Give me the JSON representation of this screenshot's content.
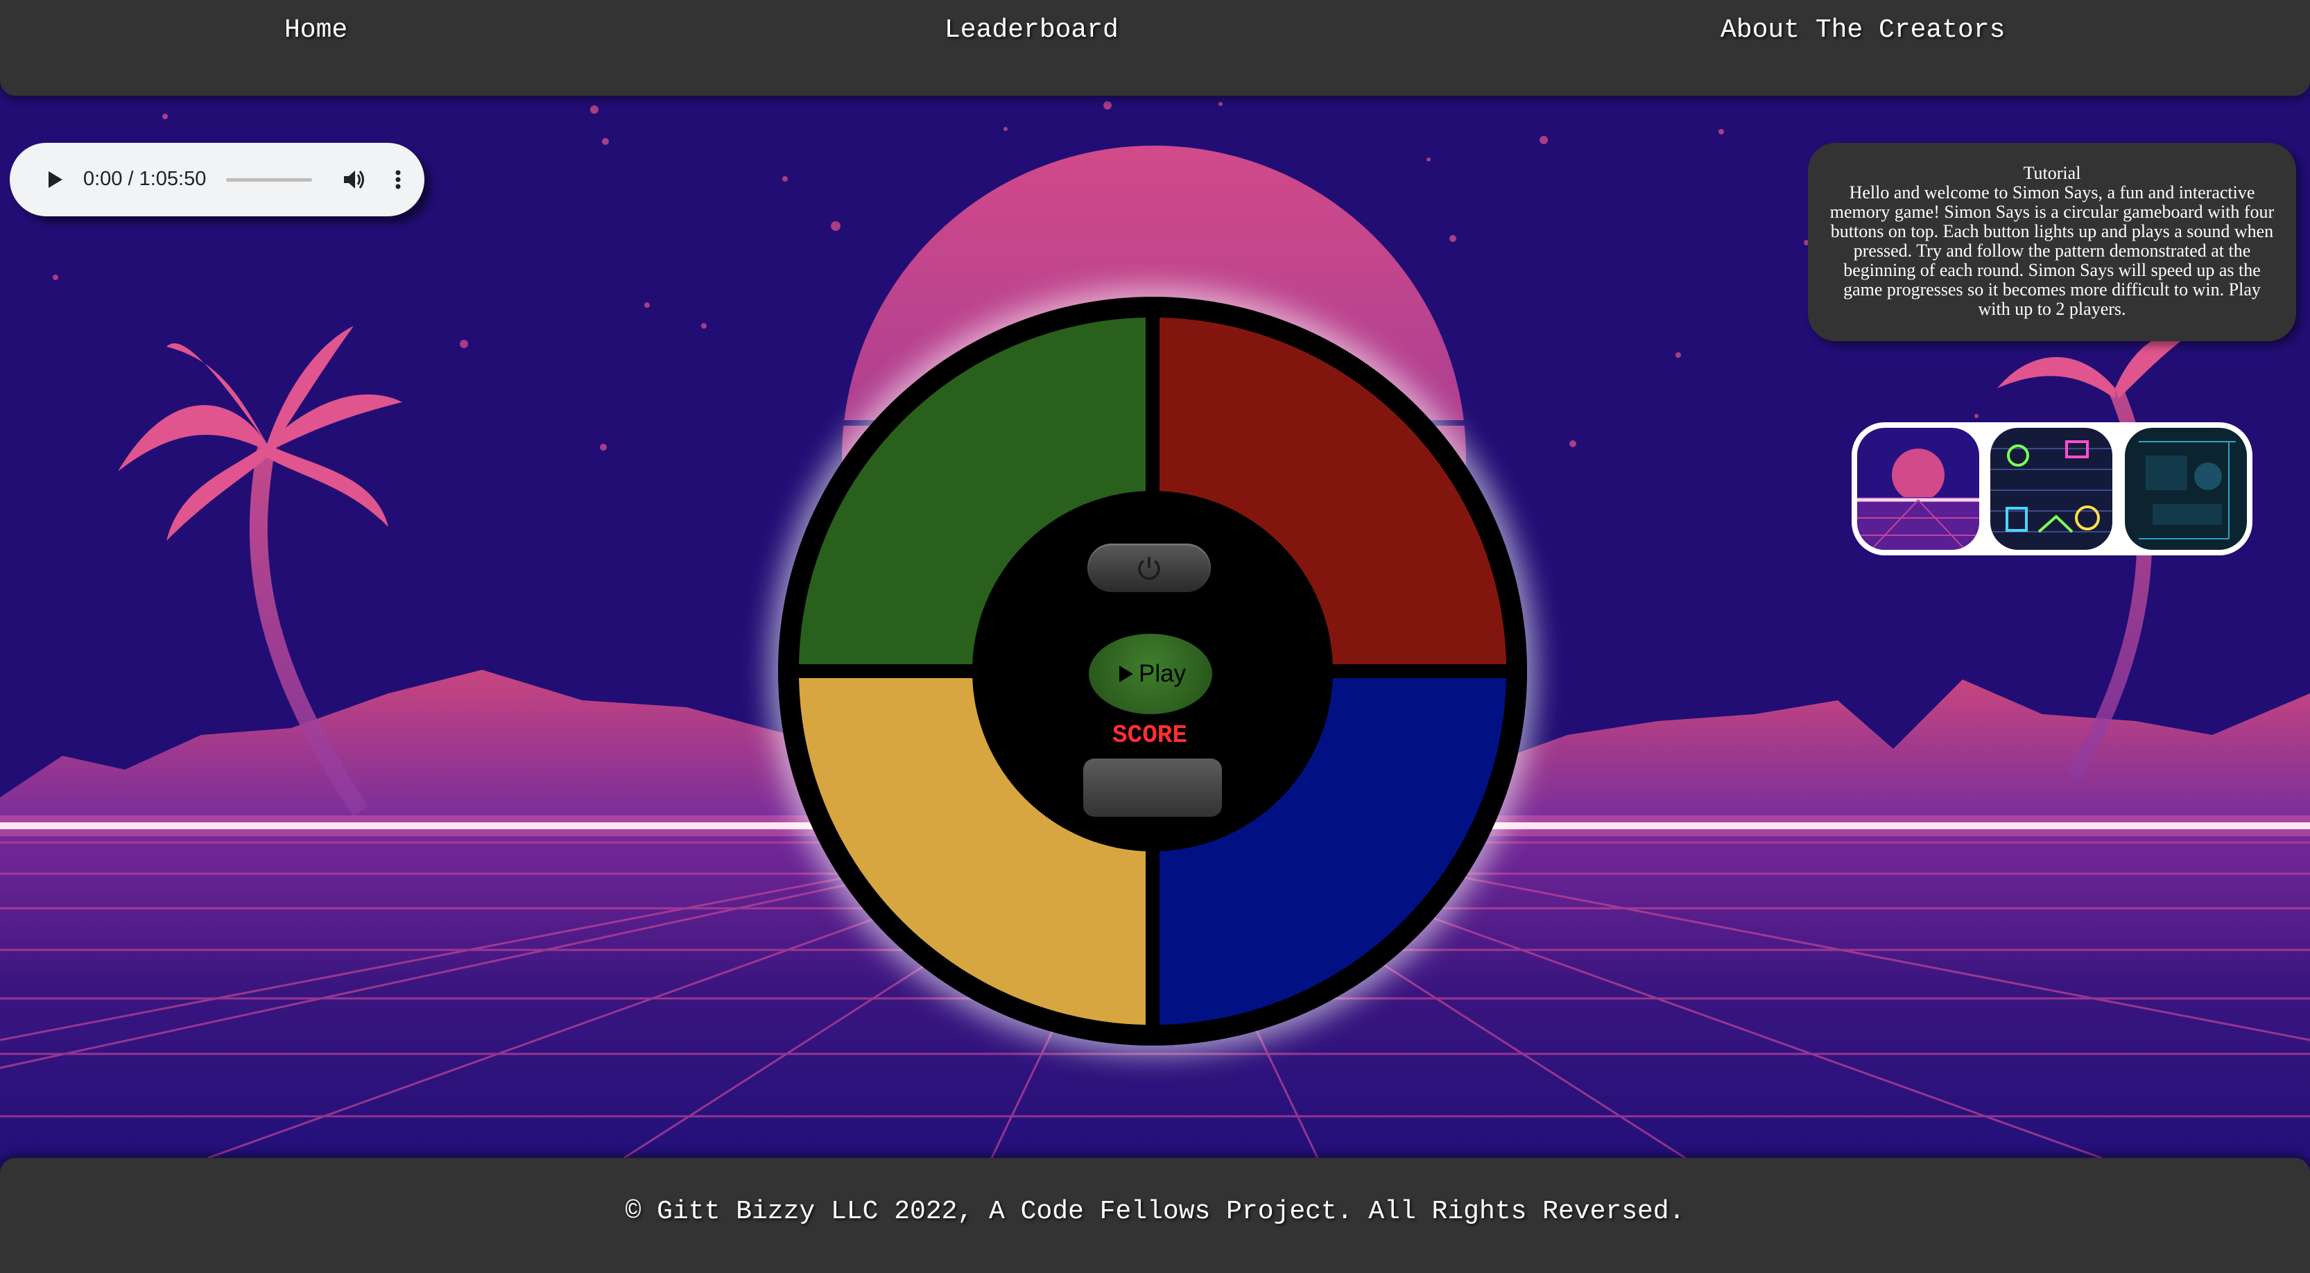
{
  "nav": {
    "home": "Home",
    "leaderboard": "Leaderboard",
    "about": "About The Creators"
  },
  "audio": {
    "time_display": "0:00 / 1:05:50",
    "progress": 0
  },
  "tutorial": {
    "title": "Tutorial",
    "body": "Hello and welcome to Simon Says, a fun and interactive memory game! Simon Says is a circular gameboard with four buttons on top. Each button lights up and plays a sound when pressed. Try and follow the pattern demonstrated at the beginning of each round. Simon Says will speed up as the game progresses so it becomes more difficult to win. Play with up to 2 players."
  },
  "themes": [
    "synthwave-sunset-theme",
    "neon-doodle-theme",
    "circuit-board-theme"
  ],
  "board": {
    "colors": {
      "green": "#29601b",
      "red": "#82160f",
      "yellow": "#d7a640",
      "blue": "#011184"
    },
    "play_label": "Play",
    "score_label": "SCORE",
    "score_value": ""
  },
  "footer": {
    "text": "© Gitt Bizzy LLC 2022, A Code Fellows Project. All Rights Reversed."
  }
}
